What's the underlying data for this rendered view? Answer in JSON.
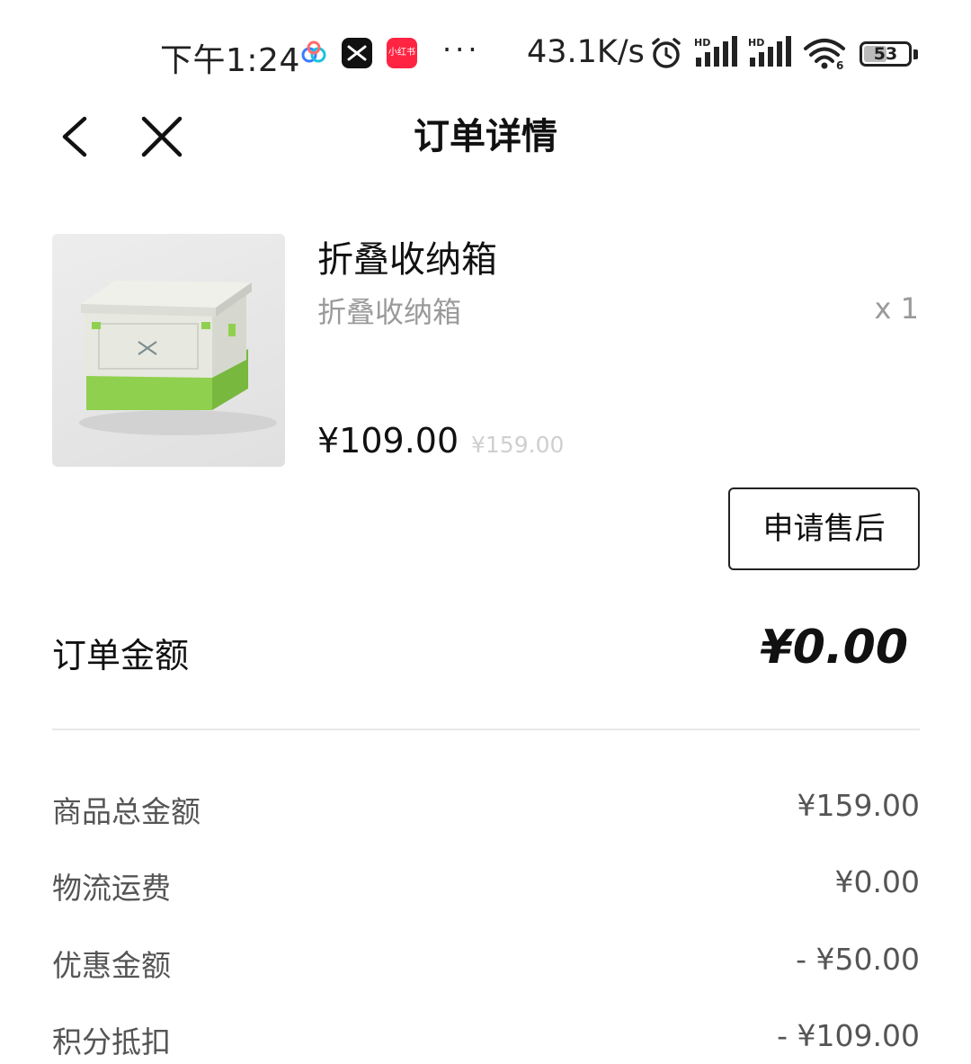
{
  "status_bar": {
    "time": "下午1:24",
    "more": "···",
    "network_speed": "43.1K/s",
    "battery": "53",
    "battery_level": 0.53,
    "icons": [
      "baidu-netdisk-icon",
      "x-app-icon",
      "xiaohongshu-icon",
      "alarm-icon",
      "hd-signal-icon",
      "hd-signal-icon",
      "wifi-icon",
      "battery-icon"
    ],
    "xhs_label": "小红书"
  },
  "header": {
    "title": "订单详情",
    "back_icon": "chevron-left-icon",
    "close_icon": "close-icon"
  },
  "product": {
    "name": "折叠收纳箱",
    "spec": "折叠收纳箱",
    "quantity": "x 1",
    "price": "¥109.00",
    "original_price": "¥159.00",
    "image": "folding-storage-box-image"
  },
  "actions": {
    "aftersale_label": "申请售后"
  },
  "order_total": {
    "label": "订单金额",
    "value": "¥0.00"
  },
  "breakdown": [
    {
      "label": "商品总金额",
      "value": "¥159.00"
    },
    {
      "label": "物流运费",
      "value": "¥0.00"
    },
    {
      "label": "优惠金额",
      "value": "- ¥50.00"
    },
    {
      "label": "积分抵扣",
      "value": "- ¥109.00"
    }
  ],
  "colors": {
    "text_primary": "#111111",
    "text_secondary": "#9a9a9a",
    "text_muted": "#cfcfcf",
    "divider": "#e8e8e8",
    "box_green": "#8fd14f"
  }
}
